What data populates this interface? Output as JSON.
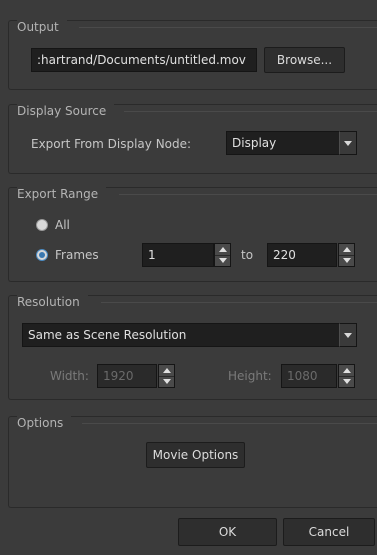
{
  "output": {
    "title": "Output",
    "path_value": ":hartrand/Documents/untitled.mov",
    "browse_label": "Browse..."
  },
  "display_source": {
    "title": "Display Source",
    "export_label": "Export From Display Node:",
    "display_value": "Display"
  },
  "export_range": {
    "title": "Export Range",
    "all_label": "All",
    "frames_label": "Frames",
    "selected": "Frames",
    "from_value": "1",
    "to_label": "to",
    "to_value": "220"
  },
  "resolution": {
    "title": "Resolution",
    "preset_value": "Same as Scene Resolution",
    "width_label": "Width:",
    "width_value": "1920",
    "height_label": "Height:",
    "height_value": "1080"
  },
  "options": {
    "title": "Options",
    "movie_options_label": "Movie Options"
  },
  "footer": {
    "ok_label": "OK",
    "cancel_label": "Cancel"
  },
  "colors": {
    "background": "#3b3b3b",
    "field_bg": "#1f1f1f",
    "radio_accent": "#3a78b0"
  }
}
